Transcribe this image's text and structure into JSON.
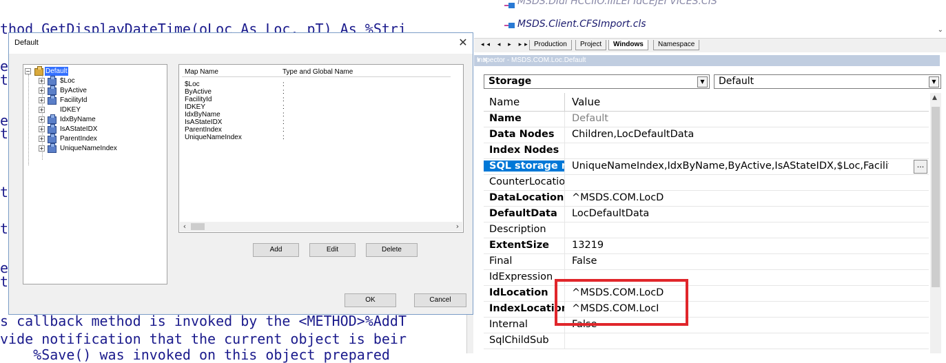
{
  "code_editor": {
    "line1": "thod GetDisplayDateTime(oLoc As Loc, pT) As %Stri",
    "fragments": [
      "e",
      "t",
      "e",
      "t",
      "t",
      "t",
      "e",
      "t"
    ],
    "line_bottom1": "s callback method is invoked by the <METHOD>%AddT",
    "line_bottom2": "vide notification that the current object is beir",
    "line_bottom3": "    %Save() was invoked on this object prepared"
  },
  "dialog": {
    "title": "Default",
    "close_glyph": "✕",
    "tree": {
      "root": "Default",
      "items": [
        "$Loc",
        "ByActive",
        "FacilityId",
        "IDKEY",
        "IdxByName",
        "IsAStateIDX",
        "ParentIndex",
        "UniqueNameIndex"
      ]
    },
    "map": {
      "col_name": "Map Name",
      "col_type": "Type and Global Name",
      "rows": [
        {
          "name": "$Loc",
          "type": ":"
        },
        {
          "name": "ByActive",
          "type": ":"
        },
        {
          "name": "FacilityId",
          "type": ":"
        },
        {
          "name": "IDKEY",
          "type": ":"
        },
        {
          "name": "IdxByName",
          "type": ":"
        },
        {
          "name": "IsAStateIDX",
          "type": ":"
        },
        {
          "name": "ParentIndex",
          "type": ":"
        },
        {
          "name": "UniqueNameIndex",
          "type": ":"
        }
      ]
    },
    "buttons": {
      "add": "Add",
      "edit": "Edit",
      "delete": "Delete",
      "ok": "OK",
      "cancel": "Cancel"
    }
  },
  "class_tree": {
    "items": [
      "MSDS.DIdl HCCIIO.IIILEI IdCEJEI VICES.CIS",
      "MSDS.Client.CFSImport.cls"
    ]
  },
  "tabs": {
    "nav": "◂◂ ◂ ▸ ▸▸",
    "items": [
      "Production",
      "Project",
      "Windows",
      "Namespace"
    ],
    "active": "Windows"
  },
  "inspector": {
    "title": "Inspector - MSDS.COM.Loc.Default",
    "category": "Storage",
    "item": "Default",
    "col_name": "Name",
    "col_value": "Value",
    "rows": [
      {
        "name": "Name",
        "value": "Default"
      },
      {
        "name": "Data Nodes",
        "value": "Children,LocDefaultData"
      },
      {
        "name": "Index Nodes",
        "value": ""
      },
      {
        "name": "SQL storage m",
        "value": "UniqueNameIndex,IdxByName,ByActive,IsAStateIDX,$Loc,FacilityId,"
      },
      {
        "name": "CounterLocatio",
        "value": ""
      },
      {
        "name": "DataLocation",
        "value": "^MSDS.COM.LocD"
      },
      {
        "name": "DefaultData",
        "value": "LocDefaultData"
      },
      {
        "name": "Description",
        "value": ""
      },
      {
        "name": "ExtentSize",
        "value": "13219"
      },
      {
        "name": "Final",
        "value": "False"
      },
      {
        "name": "IdExpression",
        "value": ""
      },
      {
        "name": "IdLocation",
        "value": "^MSDS.COM.LocD"
      },
      {
        "name": "IndexLocation",
        "value": "^MSDS.COM.LocI"
      },
      {
        "name": "Internal",
        "value": "False"
      },
      {
        "name": "SqlChildSub",
        "value": ""
      }
    ],
    "ellipsis": "..."
  },
  "colors": {
    "highlight": "#e0262b",
    "selection": "#0078d7"
  }
}
